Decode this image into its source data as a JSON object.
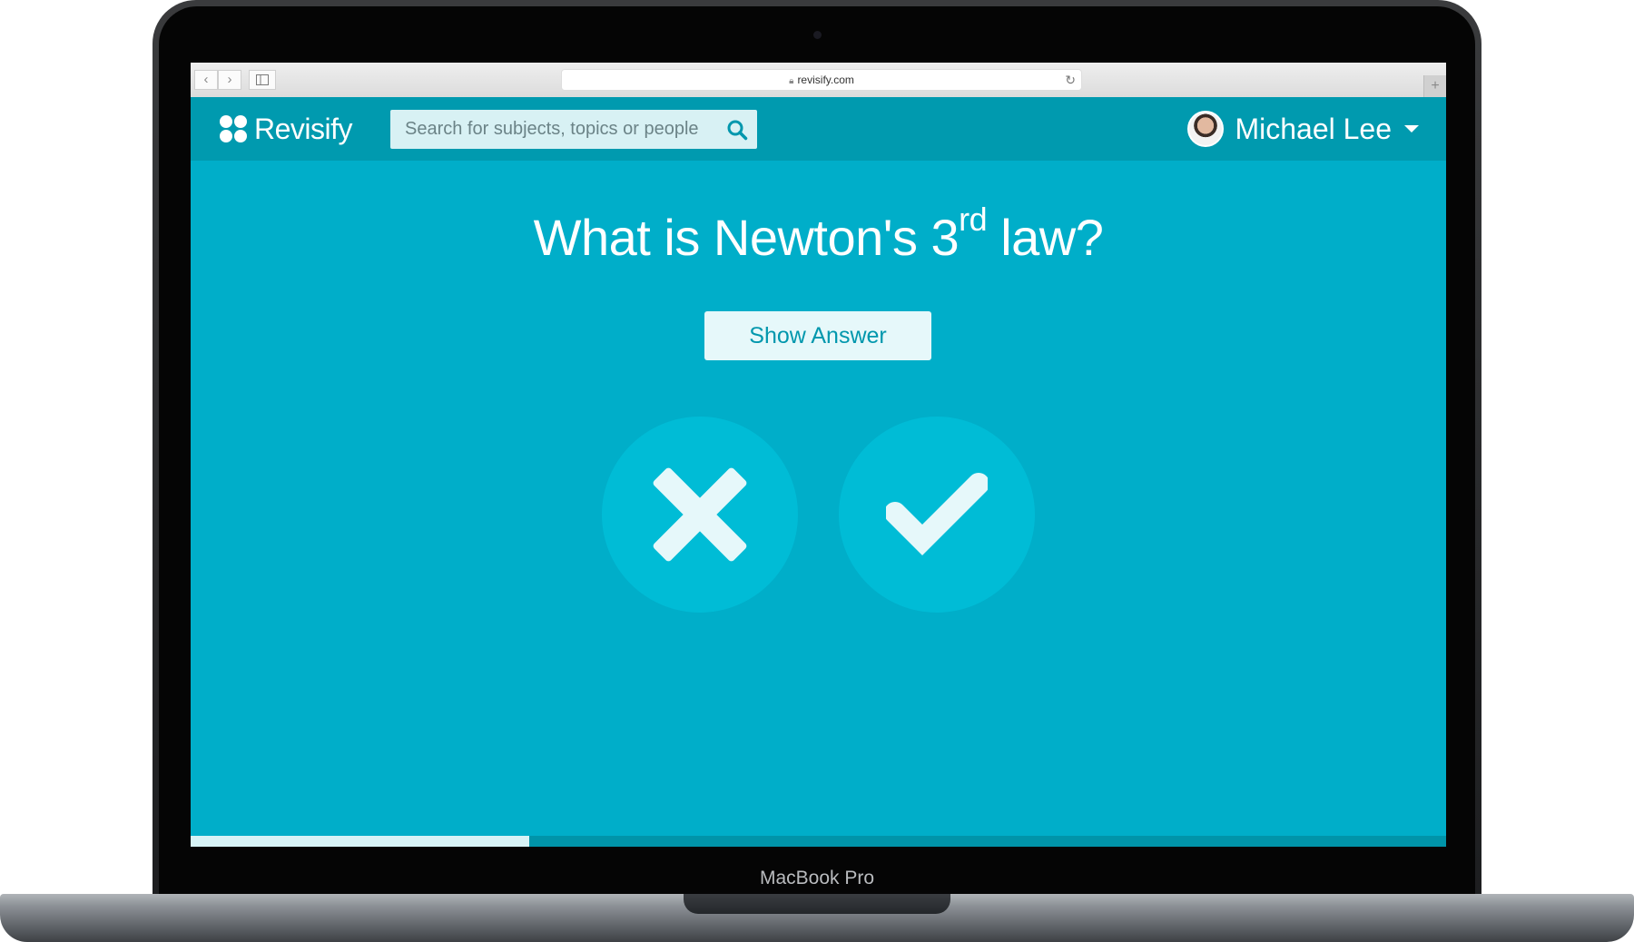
{
  "device": {
    "model_label": "MacBook Pro"
  },
  "browser": {
    "url": "revisify.com",
    "back_icon": "chevron-left-icon",
    "forward_icon": "chevron-right-icon",
    "sidebar_icon": "sidebar-icon",
    "reload_icon": "reload-icon",
    "new_tab_icon": "plus-icon"
  },
  "header": {
    "logo_text": "Revisify",
    "search_placeholder": "Search for subjects, topics or people",
    "search_value": "",
    "user_name": "Michael Lee"
  },
  "card": {
    "question_main": "What is Newton's 3",
    "question_sup": "rd",
    "question_end": " law?",
    "show_answer_label": "Show Answer",
    "wrong_icon": "x-icon",
    "right_icon": "check-icon"
  },
  "progress": {
    "fraction": 0.27
  },
  "colors": {
    "screen_bg": "#00aec9",
    "header_bg": "#009aaf",
    "circle_bg": "#00bcd6",
    "button_text": "#0097ad",
    "progress_fill": "#d7f3f6"
  }
}
